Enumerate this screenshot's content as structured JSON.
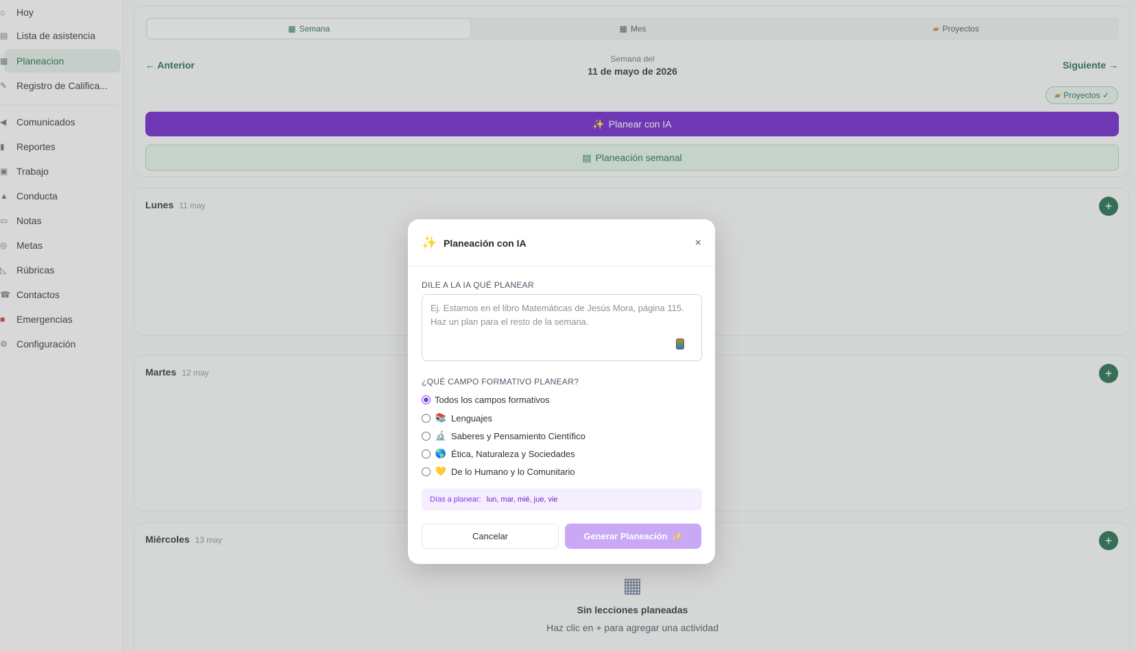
{
  "sidebar": {
    "items": [
      {
        "icon": "home-icon",
        "glyph": "⌂",
        "label": "Hoy"
      },
      {
        "icon": "checklist-icon",
        "glyph": "▤",
        "label": "Lista de asistencia"
      },
      {
        "icon": "calendar-icon",
        "glyph": "▦",
        "label": "Planeacion"
      },
      {
        "icon": "grades-icon",
        "glyph": "✎",
        "label": "Registro de Califica..."
      },
      {
        "icon": "megaphone-icon",
        "glyph": "◀",
        "label": "Comunicados"
      },
      {
        "icon": "chart-icon",
        "glyph": "▮",
        "label": "Reportes"
      },
      {
        "icon": "briefcase-icon",
        "glyph": "▣",
        "label": "Trabajo"
      },
      {
        "icon": "warning-icon",
        "glyph": "▲",
        "label": "Conducta"
      },
      {
        "icon": "note-icon",
        "glyph": "▭",
        "label": "Notas"
      },
      {
        "icon": "target-icon",
        "glyph": "◎",
        "label": "Metas"
      },
      {
        "icon": "ruler-icon",
        "glyph": "◺",
        "label": "Rúbricas"
      },
      {
        "icon": "phone-icon",
        "glyph": "☎",
        "label": "Contactos"
      },
      {
        "icon": "sos-icon",
        "glyph": "■",
        "label": "Emergencias"
      },
      {
        "icon": "gear-icon",
        "glyph": "⚙",
        "label": "Configuración"
      }
    ],
    "active_index": 2
  },
  "tabs": [
    {
      "icon": "calendar-icon",
      "glyph": "▦",
      "label": "Semana"
    },
    {
      "icon": "calendar-icon",
      "glyph": "▦",
      "label": "Mes"
    },
    {
      "icon": "folder-icon",
      "glyph": "▰",
      "label": "Proyectos"
    }
  ],
  "nav": {
    "prev": "← Anterior",
    "next": "Siguiente →",
    "week_label": "Semana del",
    "week_date": "11 de mayo de 2026"
  },
  "projects_pill": "Proyectos ✓",
  "projects_pill_glyph": "▰",
  "ai_button": "Planear con IA",
  "ai_button_glyph": "✨",
  "weekly_button": "Planeación semanal",
  "weekly_button_glyph": "▤",
  "days": [
    {
      "name": "Lunes",
      "date": "11 may"
    },
    {
      "name": "Martes",
      "date": "12 may"
    },
    {
      "name": "Miércoles",
      "date": "13 may"
    }
  ],
  "add_glyph": "+",
  "empty": {
    "glyph": "▦",
    "title": "Sin lecciones planeadas",
    "subtitle": "Haz clic en + para agregar una actividad"
  },
  "modal": {
    "star": "✨",
    "title": "Planeación con IA",
    "close": "×",
    "prompt_label": "DILE A LA IA QUÉ PLANEAR",
    "prompt_placeholder": "Ej. Estamos en el libro Matemáticas de Jesús Mora, página 115. Haz un plan para el resto de la semana.",
    "field_label": "¿QUÉ CAMPO FORMATIVO PLANEAR?",
    "options": [
      {
        "emoji": "",
        "label": "Todos los campos formativos",
        "selected": true
      },
      {
        "emoji": "📚",
        "label": "Lenguajes",
        "selected": false
      },
      {
        "emoji": "🔬",
        "label": "Saberes y Pensamiento Científico",
        "selected": false
      },
      {
        "emoji": "🌎",
        "label": "Ética, Naturaleza y Sociedades",
        "selected": false
      },
      {
        "emoji": "💛",
        "label": "De lo Humano y lo Comunitario",
        "selected": false
      }
    ],
    "days_label": "Días a planear:",
    "days_value": "lun, mar, mié, jue, vie",
    "cancel": "Cancelar",
    "generate": "Generar Planeación",
    "generate_glyph": "✨"
  },
  "colors": {
    "accent_green": "#1e6b4a",
    "ai_purple": "#6b21c8",
    "generate_disabled": "#c9a8f6"
  }
}
